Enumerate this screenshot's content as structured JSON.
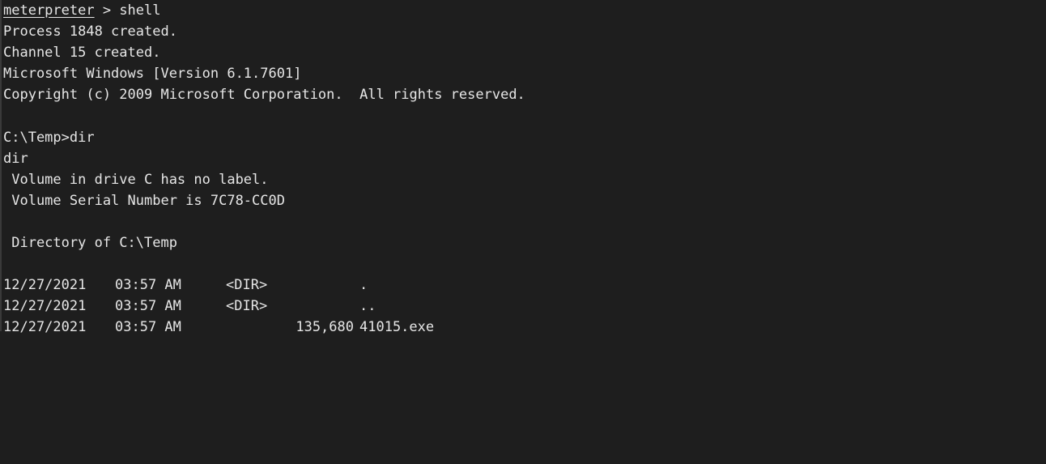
{
  "session": {
    "prompt_name": "meterpreter",
    "prompt_sep": " > ",
    "command": "shell",
    "process_msg": "Process 1848 created.",
    "channel_msg": "Channel 15 created.",
    "windows_version": "Microsoft Windows [Version 6.1.7601]",
    "copyright": "Copyright (c) 2009 Microsoft Corporation.  All rights reserved."
  },
  "cmd": {
    "prompt_line": "C:\\Temp>dir",
    "echo": "dir",
    "volume_label": " Volume in drive C has no label.",
    "volume_serial": " Volume Serial Number is 7C78-CC0D",
    "directory_of": " Directory of C:\\Temp"
  },
  "listing": [
    {
      "date": "12/27/2021",
      "time": "03:57 AM",
      "type": "<DIR>",
      "size": "",
      "name": "."
    },
    {
      "date": "12/27/2021",
      "time": "03:57 AM",
      "type": "<DIR>",
      "size": "",
      "name": ".."
    },
    {
      "date": "12/27/2021",
      "time": "03:57 AM",
      "type": "",
      "size": "135,680",
      "name": "41015.exe"
    }
  ]
}
